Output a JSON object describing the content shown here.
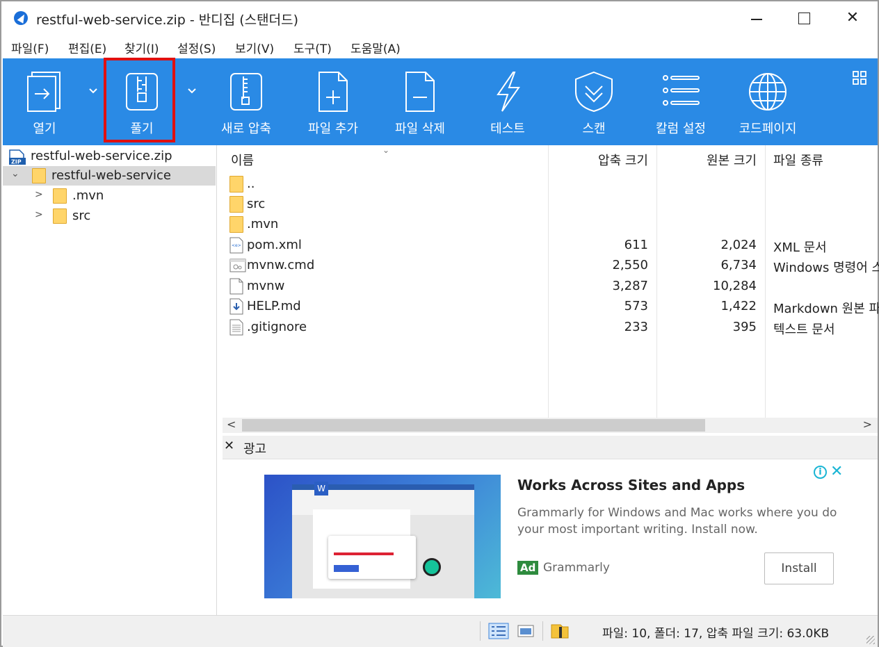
{
  "window": {
    "title": "restful-web-service.zip - 반디집 (스탠더드)"
  },
  "menu": [
    "파일(F)",
    "편집(E)",
    "찾기(I)",
    "설정(S)",
    "보기(V)",
    "도구(T)",
    "도움말(A)"
  ],
  "toolbar": {
    "open": "열기",
    "extract": "풀기",
    "new_archive": "새로 압축",
    "add_files": "파일 추가",
    "delete_files": "파일 삭제",
    "test": "테스트",
    "scan": "스캔",
    "column_settings": "칼럼 설정",
    "codepage": "코드페이지"
  },
  "tree": {
    "root": "restful-web-service.zip",
    "folder": "restful-web-service",
    "children": [
      ".mvn",
      "src"
    ]
  },
  "columns": {
    "name": "이름",
    "packed": "압축 크기",
    "original": "원본 크기",
    "type": "파일 종류"
  },
  "files": [
    {
      "name": "..",
      "packed": "",
      "original": "",
      "type": "",
      "icon": "folder-icon"
    },
    {
      "name": "src",
      "packed": "",
      "original": "",
      "type": "",
      "icon": "folder-icon"
    },
    {
      "name": ".mvn",
      "packed": "",
      "original": "",
      "type": "",
      "icon": "folder-icon"
    },
    {
      "name": "pom.xml",
      "packed": "611",
      "original": "2,024",
      "type": "XML 문서",
      "icon": "xml-file-icon"
    },
    {
      "name": "mvnw.cmd",
      "packed": "2,550",
      "original": "6,734",
      "type": "Windows 명령어 스",
      "icon": "cmd-file-icon"
    },
    {
      "name": "mvnw",
      "packed": "3,287",
      "original": "10,284",
      "type": "",
      "icon": "blank-file-icon"
    },
    {
      "name": "HELP.md",
      "packed": "573",
      "original": "1,422",
      "type": "Markdown 원본 파",
      "icon": "markdown-file-icon"
    },
    {
      "name": ".gitignore",
      "packed": "233",
      "original": "395",
      "type": "텍스트 문서",
      "icon": "text-file-icon"
    }
  ],
  "ad": {
    "header": "광고",
    "title": "Works Across Sites and Apps",
    "description": "Grammarly for Windows and Mac works where you do your most important writing. Install now.",
    "badge": "Ad",
    "brand": "Grammarly",
    "button": "Install"
  },
  "status": {
    "text": "파일: 10, 폴더: 17, 압축 파일 크기: 63.0KB"
  },
  "colors": {
    "toolbar": "#2a8ae5",
    "highlight": "#e01010",
    "folder": "#ffd56a"
  }
}
